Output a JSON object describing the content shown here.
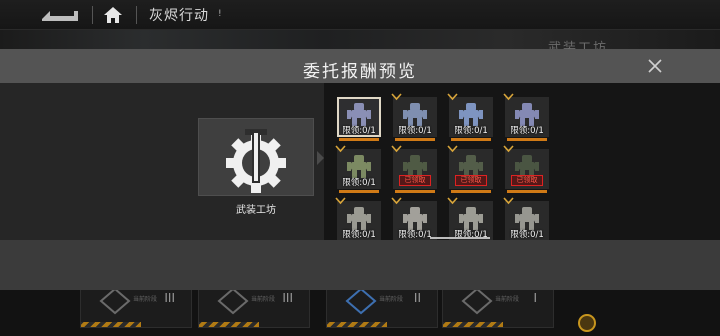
{
  "topbar": {
    "title": "灰烬行动",
    "badge": "!"
  },
  "background": {
    "scene_label": "武装工坊",
    "cards": [
      {
        "rank": "III",
        "sub": "当前阶段"
      },
      {
        "rank": "III",
        "sub": "当前阶段"
      },
      {
        "rank": "II",
        "sub": "当前阶段"
      },
      {
        "rank": "I",
        "sub": "当前阶段"
      }
    ]
  },
  "modal": {
    "title": "委托报酬预览",
    "source": {
      "label": "武装工坊",
      "icon": "gear-workshop-icon"
    },
    "rewards": [
      {
        "limit": "限领:0/1",
        "claimed": false,
        "selected": true,
        "tint": "#8a8fb5"
      },
      {
        "limit": "限领:0/1",
        "claimed": false,
        "selected": false,
        "tint": "#7f8fb0"
      },
      {
        "limit": "限领:0/1",
        "claimed": false,
        "selected": false,
        "tint": "#7e94c0"
      },
      {
        "limit": "限领:0/1",
        "claimed": false,
        "selected": false,
        "tint": "#8489b4"
      },
      {
        "limit": "限领:0/1",
        "claimed": false,
        "selected": false,
        "tint": "#7c8a62"
      },
      {
        "limit": "",
        "claimed": true,
        "stamp": "已领取",
        "selected": false,
        "tint": "#4f5a44"
      },
      {
        "limit": "",
        "claimed": true,
        "stamp": "已领取",
        "selected": false,
        "tint": "#535d49"
      },
      {
        "limit": "",
        "claimed": true,
        "stamp": "已领取",
        "selected": false,
        "tint": "#4a5542"
      },
      {
        "limit": "限领:0/1",
        "claimed": false,
        "selected": false,
        "tint": "#9a9a92"
      },
      {
        "limit": "限领:0/1",
        "claimed": false,
        "selected": false,
        "tint": "#a2a09a"
      },
      {
        "limit": "限领:0/1",
        "claimed": false,
        "selected": false,
        "tint": "#9c9c94"
      },
      {
        "limit": "限领:0/1",
        "claimed": false,
        "selected": false,
        "tint": "#969690"
      }
    ]
  },
  "colors": {
    "accent": "#d07a16",
    "stamp": "#dd2222",
    "header": "#545454"
  }
}
